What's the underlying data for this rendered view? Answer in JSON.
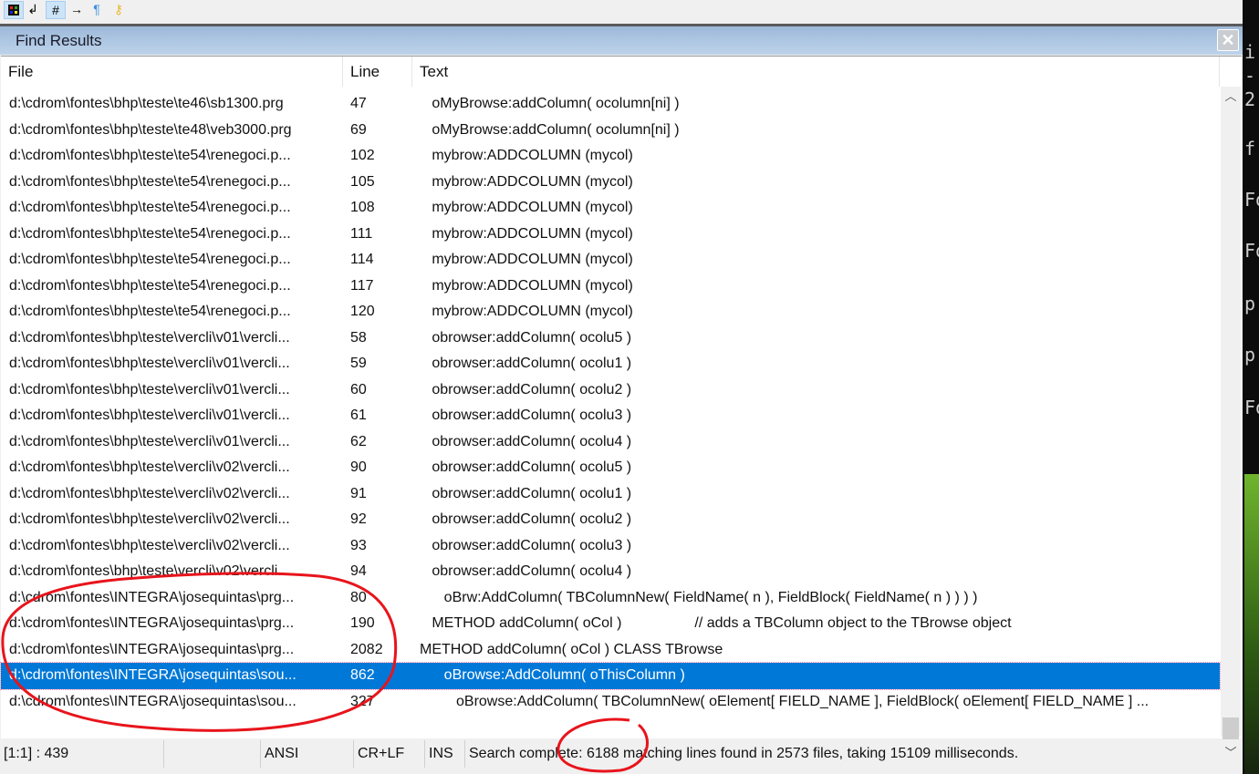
{
  "toolbar": {
    "icons": [
      "color-scheme-icon",
      "word-wrap-icon",
      "line-numbers-icon",
      "whitespace-arrow-icon",
      "pilcrow-icon",
      "key-icon"
    ]
  },
  "panel": {
    "title": "Find Results",
    "close": "✕"
  },
  "columns": {
    "file": "File",
    "line": "Line",
    "text": "Text"
  },
  "rows": [
    {
      "file": "d:\\cdrom\\fontes\\bhp\\teste\\te46\\sb1300.prg",
      "line": "47",
      "text": "   oMyBrowse:addColumn( ocolumn[ni] )"
    },
    {
      "file": "d:\\cdrom\\fontes\\bhp\\teste\\te48\\veb3000.prg",
      "line": "69",
      "text": "   oMyBrowse:addColumn( ocolumn[ni] )"
    },
    {
      "file": "d:\\cdrom\\fontes\\bhp\\teste\\te54\\renegoci.p...",
      "line": "102",
      "text": "   mybrow:ADDCOLUMN (mycol)"
    },
    {
      "file": "d:\\cdrom\\fontes\\bhp\\teste\\te54\\renegoci.p...",
      "line": "105",
      "text": "   mybrow:ADDCOLUMN (mycol)"
    },
    {
      "file": "d:\\cdrom\\fontes\\bhp\\teste\\te54\\renegoci.p...",
      "line": "108",
      "text": "   mybrow:ADDCOLUMN (mycol)"
    },
    {
      "file": "d:\\cdrom\\fontes\\bhp\\teste\\te54\\renegoci.p...",
      "line": "111",
      "text": "   mybrow:ADDCOLUMN (mycol)"
    },
    {
      "file": "d:\\cdrom\\fontes\\bhp\\teste\\te54\\renegoci.p...",
      "line": "114",
      "text": "   mybrow:ADDCOLUMN (mycol)"
    },
    {
      "file": "d:\\cdrom\\fontes\\bhp\\teste\\te54\\renegoci.p...",
      "line": "117",
      "text": "   mybrow:ADDCOLUMN (mycol)"
    },
    {
      "file": "d:\\cdrom\\fontes\\bhp\\teste\\te54\\renegoci.p...",
      "line": "120",
      "text": "   mybrow:ADDCOLUMN (mycol)"
    },
    {
      "file": "d:\\cdrom\\fontes\\bhp\\teste\\vercli\\v01\\vercli...",
      "line": "58",
      "text": "   obrowser:addColumn( ocolu5 )"
    },
    {
      "file": "d:\\cdrom\\fontes\\bhp\\teste\\vercli\\v01\\vercli...",
      "line": "59",
      "text": "   obrowser:addColumn( ocolu1 )"
    },
    {
      "file": "d:\\cdrom\\fontes\\bhp\\teste\\vercli\\v01\\vercli...",
      "line": "60",
      "text": "   obrowser:addColumn( ocolu2 )"
    },
    {
      "file": "d:\\cdrom\\fontes\\bhp\\teste\\vercli\\v01\\vercli...",
      "line": "61",
      "text": "   obrowser:addColumn( ocolu3 )"
    },
    {
      "file": "d:\\cdrom\\fontes\\bhp\\teste\\vercli\\v01\\vercli...",
      "line": "62",
      "text": "   obrowser:addColumn( ocolu4 )"
    },
    {
      "file": "d:\\cdrom\\fontes\\bhp\\teste\\vercli\\v02\\vercli...",
      "line": "90",
      "text": "   obrowser:addColumn( ocolu5 )"
    },
    {
      "file": "d:\\cdrom\\fontes\\bhp\\teste\\vercli\\v02\\vercli...",
      "line": "91",
      "text": "   obrowser:addColumn( ocolu1 )"
    },
    {
      "file": "d:\\cdrom\\fontes\\bhp\\teste\\vercli\\v02\\vercli...",
      "line": "92",
      "text": "   obrowser:addColumn( ocolu2 )"
    },
    {
      "file": "d:\\cdrom\\fontes\\bhp\\teste\\vercli\\v02\\vercli...",
      "line": "93",
      "text": "   obrowser:addColumn( ocolu3 )"
    },
    {
      "file": "d:\\cdrom\\fontes\\bhp\\teste\\vercli\\v02\\vercli...",
      "line": "94",
      "text": "   obrowser:addColumn( ocolu4 )"
    },
    {
      "file": "d:\\cdrom\\fontes\\INTEGRA\\josequintas\\prg...",
      "line": "80",
      "text": "      oBrw:AddColumn( TBColumnNew( FieldName( n ), FieldBlock( FieldName( n ) ) ) )"
    },
    {
      "file": "d:\\cdrom\\fontes\\INTEGRA\\josequintas\\prg...",
      "line": "190",
      "text": "   METHOD addColumn( oCol )                  // adds a TBColumn object to the TBrowse object"
    },
    {
      "file": "d:\\cdrom\\fontes\\INTEGRA\\josequintas\\prg...",
      "line": "2082",
      "text": "METHOD addColumn( oCol ) CLASS TBrowse"
    },
    {
      "file": "d:\\cdrom\\fontes\\INTEGRA\\josequintas\\sou...",
      "line": "862",
      "text": "      oBrowse:AddColumn( oThisColumn )",
      "selected": true
    },
    {
      "file": "d:\\cdrom\\fontes\\INTEGRA\\josequintas\\sou...",
      "line": "327",
      "text": "         oBrowse:AddColumn( TBColumnNew( oElement[ FIELD_NAME ], FieldBlock( oElement[ FIELD_NAME ] ..."
    }
  ],
  "status": {
    "position": "[1:1] : 439",
    "encoding": "ANSI",
    "eol": "CR+LF",
    "mode": "INS",
    "message": "Search complete: 6188 matching lines found in 2573 files, taking 15109 milliseconds."
  },
  "terminal": [
    "i",
    "-",
    "2",
    "f",
    "Fo",
    "Fo",
    "p",
    "p",
    "Fo"
  ],
  "colors": {
    "selection": "#0078d7",
    "annotation": "#e8141c"
  }
}
